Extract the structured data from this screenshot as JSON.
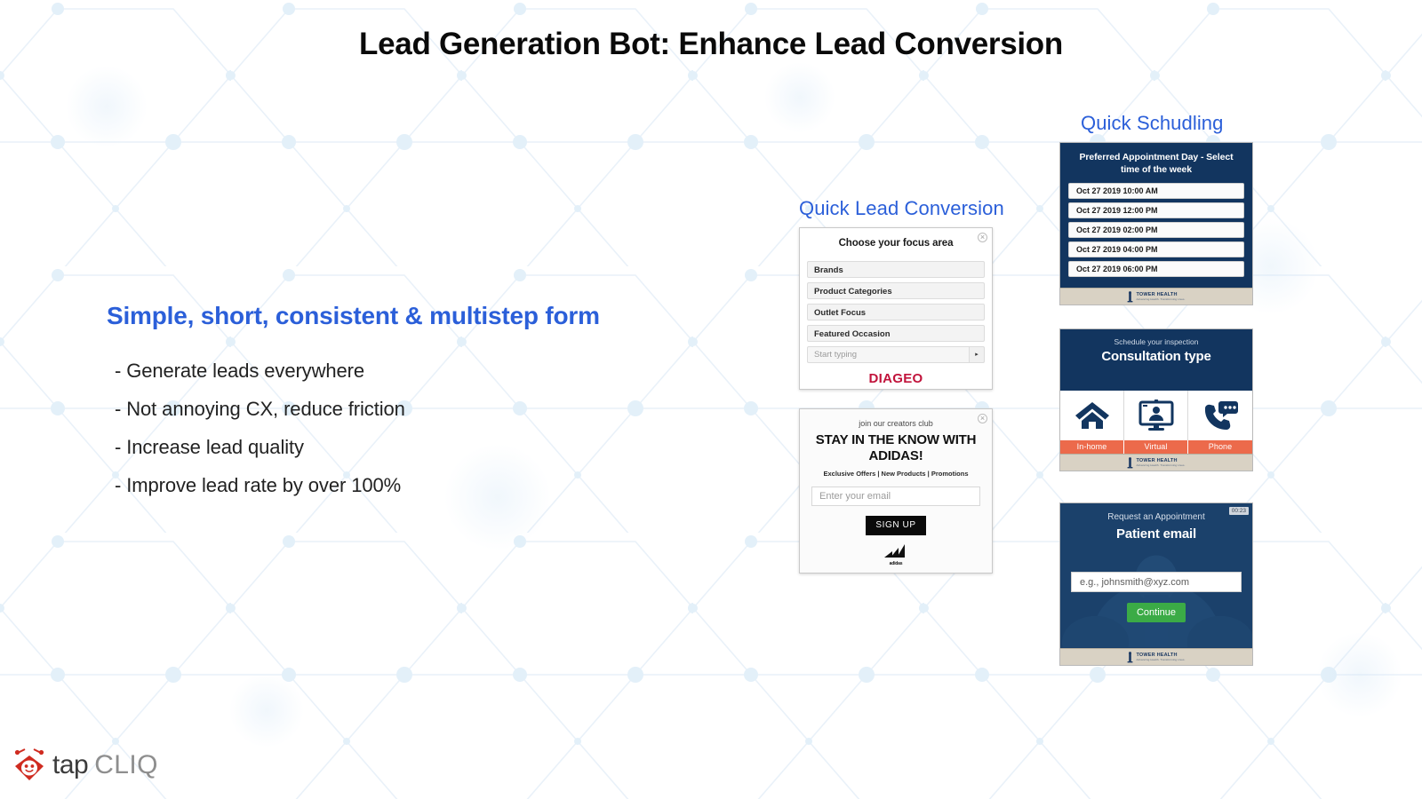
{
  "slide": {
    "title": "Lead Generation Bot: Enhance Lead Conversion"
  },
  "left": {
    "heading": "Simple, short, consistent & multistep form",
    "bullets": [
      "- Generate leads everywhere",
      "- Not annoying CX, reduce friction",
      "- Increase lead quality",
      "- Improve lead rate by over 100%"
    ]
  },
  "columns": {
    "lead_conversion_heading": "Quick Lead Conversion",
    "scheduling_heading": "Quick Schudling"
  },
  "diageo_card": {
    "title": "Choose your focus area",
    "options": [
      "Brands",
      "Product Categories",
      "Outlet Focus",
      "Featured Occasion"
    ],
    "input_placeholder": "Start typing",
    "send_glyph": "▸",
    "brand": "DIAGEO",
    "close_glyph": "×"
  },
  "adidas_card": {
    "kicker": "join our creators club",
    "headline": "STAY IN THE KNOW WITH ADIDAS!",
    "subline": "Exclusive Offers | New Products | Promotions",
    "email_placeholder": "Enter your email",
    "signup_label": "SIGN UP",
    "wordmark": "adidas",
    "close_glyph": "×"
  },
  "appointment_card": {
    "header": "Preferred Appointment Day - Select time of the week",
    "slots": [
      "Oct 27 2019 10:00 AM",
      "Oct 27 2019 12:00 PM",
      "Oct 27 2019 02:00 PM",
      "Oct 27 2019 04:00 PM",
      "Oct 27 2019 06:00 PM"
    ]
  },
  "consultation_card": {
    "kicker": "Schedule your inspection",
    "title": "Consultation type",
    "options": [
      {
        "label": "In-home",
        "icon": "home-icon"
      },
      {
        "label": "Virtual",
        "icon": "video-monitor-icon"
      },
      {
        "label": "Phone",
        "icon": "phone-chat-icon"
      }
    ]
  },
  "email_card": {
    "kicker": "Request an Appointment",
    "title": "Patient email",
    "input_placeholder": "e.g., johnsmith@xyz.com",
    "continue_label": "Continue",
    "timer": "00:23"
  },
  "tower_health_footer": {
    "name": "TOWER HEALTH",
    "tagline": "Advancing Health. Transforming Lives."
  },
  "brand": {
    "tap": "tap",
    "cliq": "CLIQ"
  },
  "colors": {
    "accent_blue": "#2b5fd9",
    "navy": "#12355f",
    "orange": "#ec6a4b",
    "green": "#3bab46",
    "diageo_red": "#c1133b",
    "beige": "#d9d2c4",
    "logo_red": "#cf2b20"
  }
}
